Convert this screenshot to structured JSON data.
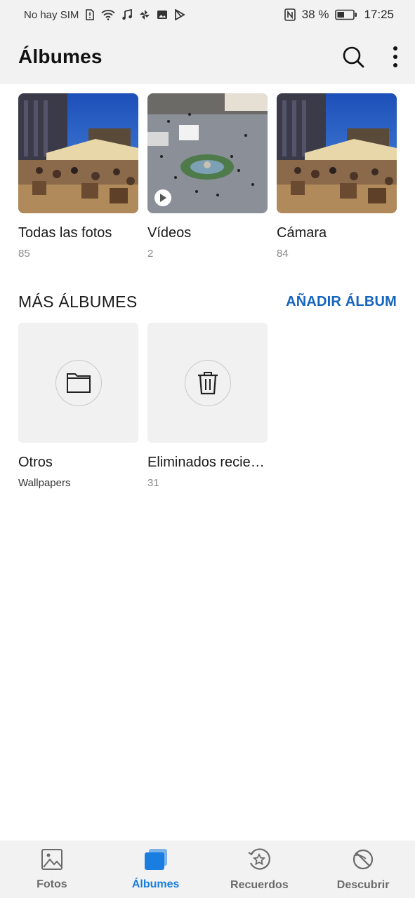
{
  "status_bar": {
    "carrier": "No hay SIM",
    "battery": "38 %",
    "time": "17:25"
  },
  "header": {
    "title": "Álbumes",
    "search_icon": "search-icon",
    "more_icon": "more-vertical-icon"
  },
  "albums": [
    {
      "name": "Todas las fotos",
      "count": "85"
    },
    {
      "name": "Vídeos",
      "count": "2"
    },
    {
      "name": "Cámara",
      "count": "84"
    }
  ],
  "more_albums": {
    "title": "MÁS ÁLBUMES",
    "action": "AÑADIR ÁLBUM",
    "items": [
      {
        "name": "Otros",
        "sub": "Wallpapers",
        "icon": "folder-icon"
      },
      {
        "name": "Eliminados recie…",
        "count": "31",
        "icon": "trash-icon"
      }
    ]
  },
  "bottom_nav": [
    {
      "label": "Fotos",
      "icon": "image-icon",
      "active": false
    },
    {
      "label": "Álbumes",
      "icon": "albums-icon",
      "active": true
    },
    {
      "label": "Recuerdos",
      "icon": "memories-star-icon",
      "active": false
    },
    {
      "label": "Descubrir",
      "icon": "discover-planet-icon",
      "active": false
    }
  ],
  "colors": {
    "accent": "#1a7ee0",
    "action_text": "#1565c0",
    "bar_background": "#f2f2f2"
  }
}
